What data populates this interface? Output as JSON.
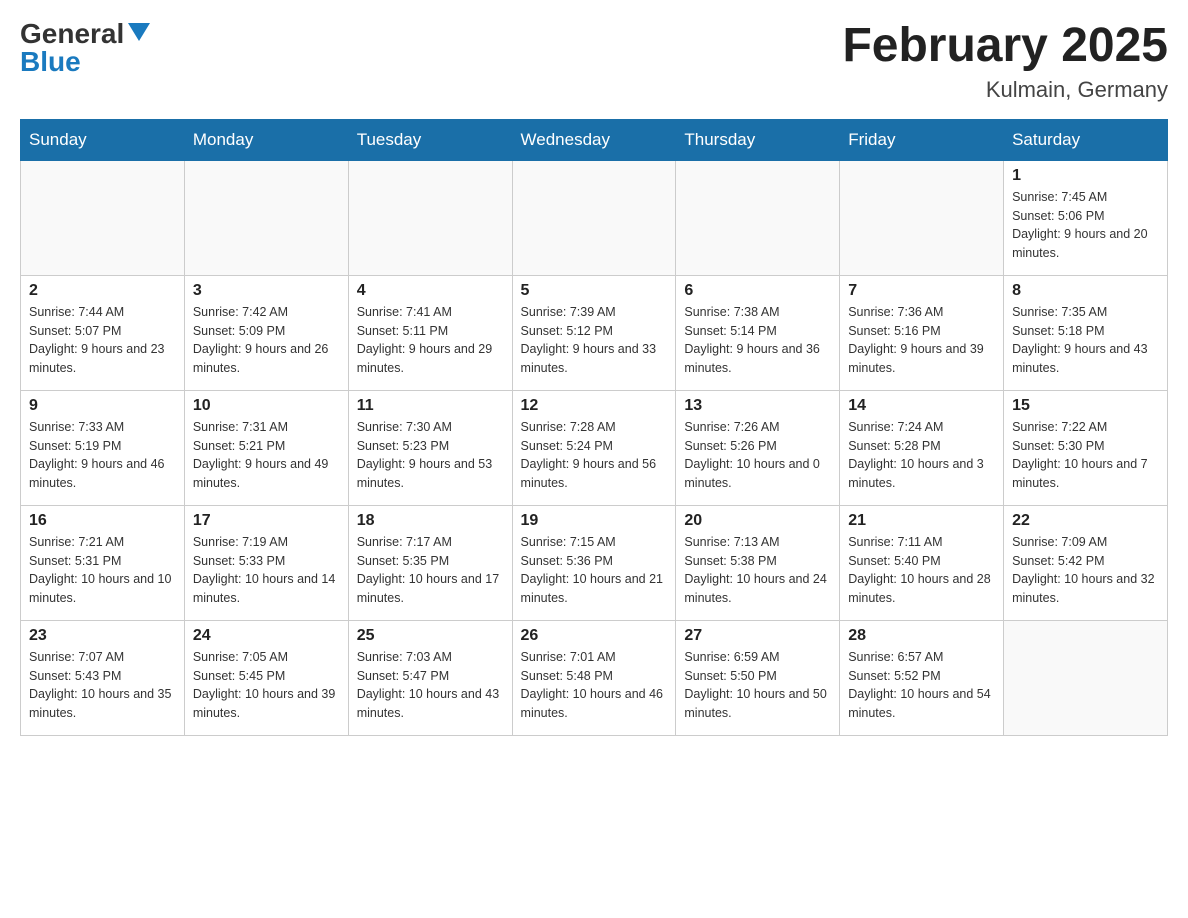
{
  "header": {
    "logo_general": "General",
    "logo_arrow": "▲",
    "logo_blue": "Blue",
    "month": "February 2025",
    "location": "Kulmain, Germany"
  },
  "weekdays": [
    "Sunday",
    "Monday",
    "Tuesday",
    "Wednesday",
    "Thursday",
    "Friday",
    "Saturday"
  ],
  "weeks": [
    [
      {
        "day": "",
        "info": ""
      },
      {
        "day": "",
        "info": ""
      },
      {
        "day": "",
        "info": ""
      },
      {
        "day": "",
        "info": ""
      },
      {
        "day": "",
        "info": ""
      },
      {
        "day": "",
        "info": ""
      },
      {
        "day": "1",
        "info": "Sunrise: 7:45 AM\nSunset: 5:06 PM\nDaylight: 9 hours and 20 minutes."
      }
    ],
    [
      {
        "day": "2",
        "info": "Sunrise: 7:44 AM\nSunset: 5:07 PM\nDaylight: 9 hours and 23 minutes."
      },
      {
        "day": "3",
        "info": "Sunrise: 7:42 AM\nSunset: 5:09 PM\nDaylight: 9 hours and 26 minutes."
      },
      {
        "day": "4",
        "info": "Sunrise: 7:41 AM\nSunset: 5:11 PM\nDaylight: 9 hours and 29 minutes."
      },
      {
        "day": "5",
        "info": "Sunrise: 7:39 AM\nSunset: 5:12 PM\nDaylight: 9 hours and 33 minutes."
      },
      {
        "day": "6",
        "info": "Sunrise: 7:38 AM\nSunset: 5:14 PM\nDaylight: 9 hours and 36 minutes."
      },
      {
        "day": "7",
        "info": "Sunrise: 7:36 AM\nSunset: 5:16 PM\nDaylight: 9 hours and 39 minutes."
      },
      {
        "day": "8",
        "info": "Sunrise: 7:35 AM\nSunset: 5:18 PM\nDaylight: 9 hours and 43 minutes."
      }
    ],
    [
      {
        "day": "9",
        "info": "Sunrise: 7:33 AM\nSunset: 5:19 PM\nDaylight: 9 hours and 46 minutes."
      },
      {
        "day": "10",
        "info": "Sunrise: 7:31 AM\nSunset: 5:21 PM\nDaylight: 9 hours and 49 minutes."
      },
      {
        "day": "11",
        "info": "Sunrise: 7:30 AM\nSunset: 5:23 PM\nDaylight: 9 hours and 53 minutes."
      },
      {
        "day": "12",
        "info": "Sunrise: 7:28 AM\nSunset: 5:24 PM\nDaylight: 9 hours and 56 minutes."
      },
      {
        "day": "13",
        "info": "Sunrise: 7:26 AM\nSunset: 5:26 PM\nDaylight: 10 hours and 0 minutes."
      },
      {
        "day": "14",
        "info": "Sunrise: 7:24 AM\nSunset: 5:28 PM\nDaylight: 10 hours and 3 minutes."
      },
      {
        "day": "15",
        "info": "Sunrise: 7:22 AM\nSunset: 5:30 PM\nDaylight: 10 hours and 7 minutes."
      }
    ],
    [
      {
        "day": "16",
        "info": "Sunrise: 7:21 AM\nSunset: 5:31 PM\nDaylight: 10 hours and 10 minutes."
      },
      {
        "day": "17",
        "info": "Sunrise: 7:19 AM\nSunset: 5:33 PM\nDaylight: 10 hours and 14 minutes."
      },
      {
        "day": "18",
        "info": "Sunrise: 7:17 AM\nSunset: 5:35 PM\nDaylight: 10 hours and 17 minutes."
      },
      {
        "day": "19",
        "info": "Sunrise: 7:15 AM\nSunset: 5:36 PM\nDaylight: 10 hours and 21 minutes."
      },
      {
        "day": "20",
        "info": "Sunrise: 7:13 AM\nSunset: 5:38 PM\nDaylight: 10 hours and 24 minutes."
      },
      {
        "day": "21",
        "info": "Sunrise: 7:11 AM\nSunset: 5:40 PM\nDaylight: 10 hours and 28 minutes."
      },
      {
        "day": "22",
        "info": "Sunrise: 7:09 AM\nSunset: 5:42 PM\nDaylight: 10 hours and 32 minutes."
      }
    ],
    [
      {
        "day": "23",
        "info": "Sunrise: 7:07 AM\nSunset: 5:43 PM\nDaylight: 10 hours and 35 minutes."
      },
      {
        "day": "24",
        "info": "Sunrise: 7:05 AM\nSunset: 5:45 PM\nDaylight: 10 hours and 39 minutes."
      },
      {
        "day": "25",
        "info": "Sunrise: 7:03 AM\nSunset: 5:47 PM\nDaylight: 10 hours and 43 minutes."
      },
      {
        "day": "26",
        "info": "Sunrise: 7:01 AM\nSunset: 5:48 PM\nDaylight: 10 hours and 46 minutes."
      },
      {
        "day": "27",
        "info": "Sunrise: 6:59 AM\nSunset: 5:50 PM\nDaylight: 10 hours and 50 minutes."
      },
      {
        "day": "28",
        "info": "Sunrise: 6:57 AM\nSunset: 5:52 PM\nDaylight: 10 hours and 54 minutes."
      },
      {
        "day": "",
        "info": ""
      }
    ]
  ]
}
